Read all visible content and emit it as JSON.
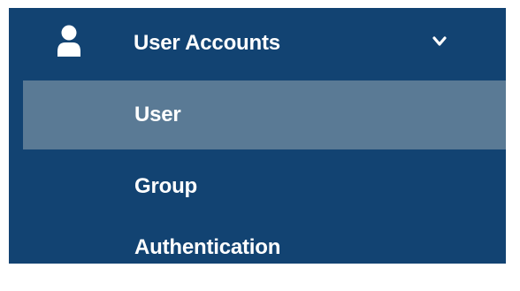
{
  "colors": {
    "panel_background": "#124372",
    "active_item_background": "#5a7a95",
    "text": "#ffffff"
  },
  "menu": {
    "header": {
      "icon": "user-icon",
      "label": "User Accounts",
      "expand_icon": "chevron-down-icon",
      "expanded": true
    },
    "items": [
      {
        "label": "User",
        "active": true
      },
      {
        "label": "Group",
        "active": false
      },
      {
        "label": "Authentication",
        "active": false
      }
    ]
  }
}
